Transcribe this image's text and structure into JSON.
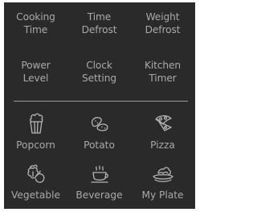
{
  "function_buttons": [
    {
      "line1": "Cooking",
      "line2": "Time"
    },
    {
      "line1": "Time",
      "line2": "Defrost"
    },
    {
      "line1": "Weight",
      "line2": "Defrost"
    },
    {
      "line1": "Power",
      "line2": "Level"
    },
    {
      "line1": "Clock",
      "line2": "Setting"
    },
    {
      "line1": "Kitchen",
      "line2": "Timer"
    }
  ],
  "food_buttons": [
    {
      "label": "Popcorn",
      "icon": "popcorn-icon"
    },
    {
      "label": "Potato",
      "icon": "potato-icon"
    },
    {
      "label": "Pizza",
      "icon": "pizza-icon"
    },
    {
      "label": "Vegetable",
      "icon": "vegetable-icon"
    },
    {
      "label": "Beverage",
      "icon": "beverage-icon"
    },
    {
      "label": "My Plate",
      "icon": "plate-icon"
    }
  ],
  "colors": {
    "panel_background": "#2a2a2a",
    "text": "#a9a9a9",
    "divider": "#9c9c9c"
  }
}
